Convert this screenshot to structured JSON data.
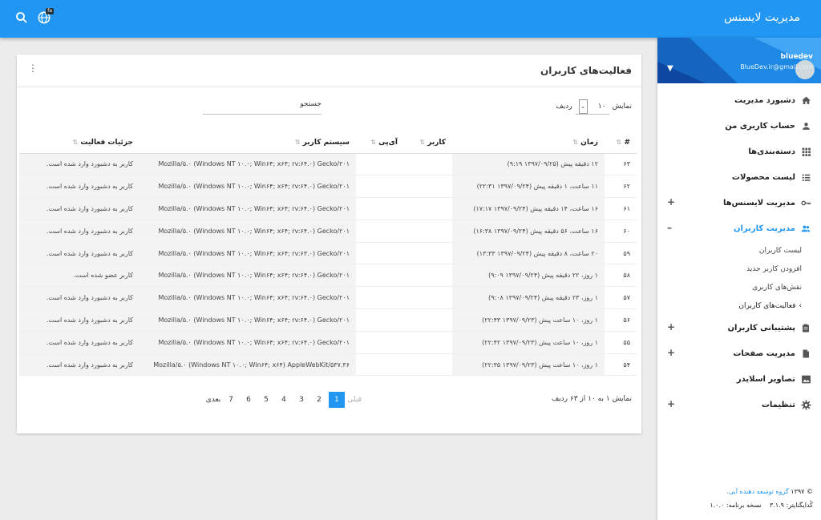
{
  "topbar": {
    "title": "مدیریت لایسنس",
    "lang_badge": "fa"
  },
  "profile": {
    "username": "bluedev",
    "email": "BlueDev.ir@gmail.com"
  },
  "nav": [
    {
      "label": "دشبورد مدیریت",
      "icon": "home-icon",
      "plus": false
    },
    {
      "label": "حساب کاربری من",
      "icon": "person-icon",
      "plus": false
    },
    {
      "label": "دسته‌بندی‌ها",
      "icon": "grid-icon",
      "plus": false
    },
    {
      "label": "لیست محصولات",
      "icon": "list-icon",
      "plus": false
    },
    {
      "label": "مدیریت لایسنس‌ها",
      "icon": "key-icon",
      "plus": true
    },
    {
      "label": "مدیریت کاربران",
      "icon": "people-icon",
      "plus": false,
      "minus": true
    }
  ],
  "nav_minus": "–",
  "nav_plus": "+",
  "subnav": [
    {
      "label": "لیست کاربران"
    },
    {
      "label": "افزودن کاربر جدید"
    },
    {
      "label": "نقش‌های کاربری"
    },
    {
      "label": "فعالیت‌های کاربران",
      "current": true
    }
  ],
  "nav2": [
    {
      "label": "پشتیبانی کاربران",
      "icon": "clipboard-icon",
      "plus": true
    },
    {
      "label": "مدیریت صفحات",
      "icon": "file-icon",
      "plus": true
    },
    {
      "label": "تصاویر اسلایدر",
      "icon": "image-icon",
      "plus": false
    },
    {
      "label": "تنظیمات",
      "icon": "gear-icon",
      "plus": true
    }
  ],
  "footer": {
    "copyright": "© ۱۳۹۷",
    "org": "گروه توسعه دهنده آبی.",
    "codeigniter": "کُدایگنایتر: ۳.۱.۹",
    "version": "نسخه برنامه: ۱.۰.۰"
  },
  "card": {
    "title": "فعالیت‌های کاربران",
    "show_label": "نمایش",
    "show_value": "۱۰",
    "rows_label": "ردیف",
    "search_label": "جستجو"
  },
  "table": {
    "headers": [
      "#",
      "زمان",
      "کاربر",
      "آی‌پی",
      "سیستم کاربر",
      "جزئیات فعالیت"
    ],
    "rows": [
      {
        "id": "۶۳",
        "time": "۱۲ دقیقه پیش (۱۳۹۷/۰۹/۲۵ ۹:۱۹)",
        "ua": "Mozilla/۵.۰ (Windows NT ۱۰.۰; Win۶۴; x۶۴; rv:۶۴.۰) Gecko/۲۰۱",
        "detail": "کاربر به دشبورد وارد شده است."
      },
      {
        "id": "۶۲",
        "time": "۱۱ ساعت، ۱ دقیقه پیش (۱۳۹۷/۰۹/۲۴ ۲۲:۳۱)",
        "ua": "Mozilla/۵.۰ (Windows NT ۱۰.۰; Win۶۴; x۶۴; rv:۶۴.۰) Gecko/۲۰۱",
        "detail": "کاربر به دشبورد وارد شده است."
      },
      {
        "id": "۶۱",
        "time": "۱۶ ساعت، ۱۴ دقیقه پیش (۱۳۹۷/۰۹/۲۴ ۱۷:۱۷)",
        "ua": "Mozilla/۵.۰ (Windows NT ۱۰.۰; Win۶۴; x۶۴; rv:۶۴.۰) Gecko/۲۰۱",
        "detail": "کاربر به دشبورد وارد شده است."
      },
      {
        "id": "۶۰",
        "time": "۱۶ ساعت، ۵۶ دقیقه پیش (۱۳۹۷/۰۹/۲۴ ۱۶:۳۸)",
        "ua": "Mozilla/۵.۰ (Windows NT ۱۰.۰; Win۶۴; x۶۴; rv:۶۴.۰) Gecko/۲۰۱",
        "detail": "کاربر به دشبورد وارد شده است."
      },
      {
        "id": "۵۹",
        "time": "۲۰ ساعت، ۸ دقیقه پیش (۱۳۹۷/۰۹/۲۴ ۱۳:۳۳)",
        "ua": "Mozilla/۵.۰ (Windows NT ۱۰.۰; Win۶۴; x۶۴; rv:۶۳.۰) Gecko/۲۰۱",
        "detail": "کاربر به دشبورد وارد شده است."
      },
      {
        "id": "۵۸",
        "time": "۱ روز، ۲۲ دقیقه پیش (۱۳۹۷/۰۹/۲۴ ۹:۰۹)",
        "ua": "Mozilla/۵.۰ (Windows NT ۱۰.۰; Win۶۴; x۶۴; rv:۶۴.۰) Gecko/۲۰۱",
        "detail": "کاربر عضو شده است."
      },
      {
        "id": "۵۷",
        "time": "۱ روز، ۲۳ دقیقه پیش (۱۳۹۷/۰۹/۲۴ ۹:۰۸)",
        "ua": "Mozilla/۵.۰ (Windows NT ۱۰.۰; Win۶۴; x۶۴; rv:۶۴.۰) Gecko/۲۰۱",
        "detail": "کاربر به دشبورد وارد شده است."
      },
      {
        "id": "۵۶",
        "time": "۱ روز، ۱۰ ساعت پیش (۱۳۹۷/۰۹/۲۳ ۲۲:۴۳)",
        "ua": "Mozilla/۵.۰ (Windows NT ۱۰.۰; Win۶۴; x۶۴; rv:۶۴.۰) Gecko/۲۰۱",
        "detail": "کاربر به دشبورد وارد شده است."
      },
      {
        "id": "۵۵",
        "time": "۱ روز، ۱۰ ساعت پیش (۱۳۹۷/۰۹/۲۳ ۲۲:۴۲)",
        "ua": "Mozilla/۵.۰ (Windows NT ۱۰.۰; Win۶۴; x۶۴; rv:۶۴.۰) Gecko/۲۰۱",
        "detail": "کاربر به دشبورد وارد شده است."
      },
      {
        "id": "۵۴",
        "time": "۱ روز، ۱۰ ساعت پیش (۱۳۹۷/۰۹/۲۳ ۲۲:۳۵)",
        "ua": "Mozilla/۵.۰ (Windows NT ۱۰.۰; Win۶۴; x۶۴) AppleWebKit/۵۳۷.۳۶",
        "detail": "کاربر به دشبورد وارد شده است."
      }
    ]
  },
  "pagination": {
    "info": "نمایش ۱ به ۱۰ از ۶۳ ردیف",
    "prev": "قبلی",
    "next": "بعدی",
    "pages": [
      "1",
      "2",
      "3",
      "4",
      "5",
      "6",
      "7"
    ],
    "current": "1"
  },
  "colors": {
    "primary": "#2196f3"
  }
}
